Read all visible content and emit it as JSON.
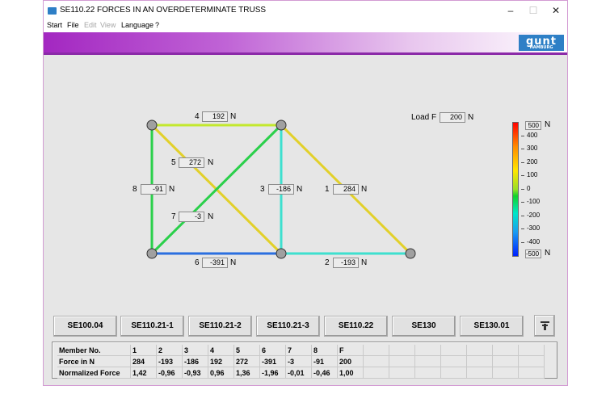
{
  "window": {
    "title": "SE110.22 FORCES IN AN OVERDETERMINATE TRUSS",
    "controls": {
      "minimize": "–",
      "maximize": "☐",
      "close": "✕"
    }
  },
  "menu": {
    "items": [
      {
        "label": "Start",
        "enabled": true
      },
      {
        "label": "File",
        "enabled": true
      },
      {
        "label": "Edit",
        "enabled": false
      },
      {
        "label": "View",
        "enabled": false
      },
      {
        "label": "Language",
        "enabled": true
      },
      {
        "label": "?",
        "enabled": true
      }
    ]
  },
  "logo": {
    "text": "gunt",
    "subtext": "HAMBURG"
  },
  "colors": {
    "banner_start": "#a327c1",
    "member_node": "#a0a0a0",
    "logo": "#2e7fc6"
  },
  "load": {
    "label": "Load F",
    "value": "200",
    "unit": "N"
  },
  "members": [
    {
      "no": "1",
      "value": "284",
      "unit": "N",
      "color": "#e2d02a"
    },
    {
      "no": "2",
      "value": "-193",
      "unit": "N",
      "color": "#3ee0cf"
    },
    {
      "no": "3",
      "value": "-186",
      "unit": "N",
      "color": "#3ee0cf"
    },
    {
      "no": "4",
      "value": "192",
      "unit": "N",
      "color": "#c3e82d"
    },
    {
      "no": "5",
      "value": "272",
      "unit": "N",
      "color": "#e2d02a"
    },
    {
      "no": "6",
      "value": "-391",
      "unit": "N",
      "color": "#2a6fe0"
    },
    {
      "no": "7",
      "value": "-3",
      "unit": "N",
      "color": "#2bd04b"
    },
    {
      "no": "8",
      "value": "-91",
      "unit": "N",
      "color": "#2bd04b"
    }
  ],
  "scale": {
    "top_value": "500",
    "bottom_value": "-500",
    "unit": "N",
    "labels": [
      "400",
      "300",
      "200",
      "100",
      "0",
      "-100",
      "-200",
      "-300",
      "-400"
    ]
  },
  "nav_buttons": [
    "SE100.04",
    "SE110.21-1",
    "SE110.21-2",
    "SE110.21-3",
    "SE110.22",
    "SE130",
    "SE130.01"
  ],
  "table": {
    "headers": [
      "Member No.",
      "1",
      "2",
      "3",
      "4",
      "5",
      "6",
      "7",
      "8",
      "F"
    ],
    "rows": [
      [
        "Force in N",
        "284",
        "-193",
        "-186",
        "192",
        "272",
        "-391",
        "-3",
        "-91",
        "200"
      ],
      [
        "Normalized Force",
        "1,42",
        "-0,96",
        "-0,93",
        "0,96",
        "1,36",
        "-1,96",
        "-0,01",
        "-0,46",
        "1,00"
      ]
    ]
  }
}
